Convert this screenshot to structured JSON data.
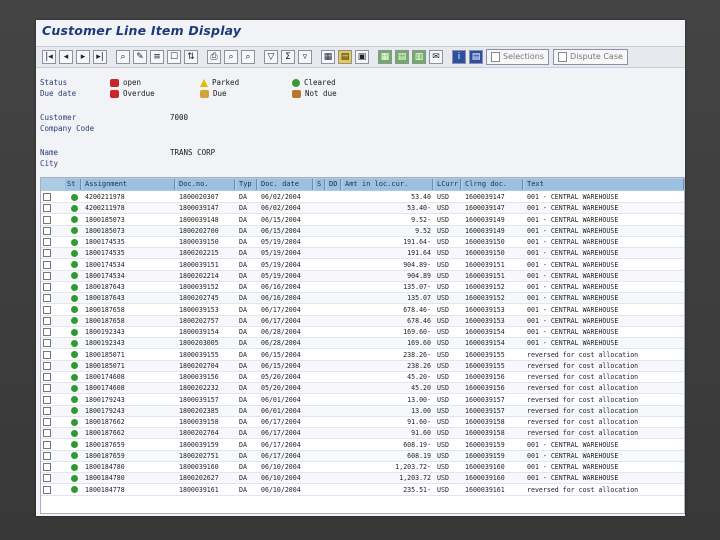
{
  "window": {
    "title": "Customer Line Item Display"
  },
  "toolbar": {
    "selections_label": "Selections",
    "dispute_label": "Dispute Case"
  },
  "legend": {
    "status_label": "Status",
    "due_date_label": "Due date",
    "open": "open",
    "overdue": "Overdue",
    "parked": "Parked",
    "due": "Due",
    "cleared": "Cleared",
    "not_due": "Not due"
  },
  "header": {
    "customer_label": "Customer",
    "company_code_label": "Company Code",
    "customer_value": "7000",
    "name_label": "Name",
    "city_label": "City",
    "name_value": "TRANS CORP"
  },
  "table": {
    "columns": [
      "St",
      "Assignment",
      "Doc.no.",
      "Typ",
      "Doc. date",
      "S",
      "DD",
      "Amt in loc.cur.",
      "LCurr",
      "Clrng doc.",
      "Text"
    ],
    "rows": [
      [
        "4200211978",
        "1800020307",
        "DA",
        "06/02/2004",
        "53.40",
        "USD",
        "1600039147",
        "001 - CENTRAL WAREHOUSE"
      ],
      [
        "4200211978",
        "1800039147",
        "DA",
        "06/02/2004",
        "53.40-",
        "USD",
        "1600039147",
        "001 - CENTRAL WAREHOUSE"
      ],
      [
        "1800185073",
        "1800039148",
        "DA",
        "06/15/2004",
        "9.52-",
        "USD",
        "1600039149",
        "001 - CENTRAL WAREHOUSE"
      ],
      [
        "1800185073",
        "1800202700",
        "DA",
        "06/15/2004",
        "9.52",
        "USD",
        "1600039149",
        "001 - CENTRAL WAREHOUSE"
      ],
      [
        "1800174535",
        "1800039150",
        "DA",
        "05/19/2004",
        "191.64-",
        "USD",
        "1600039150",
        "001 - CENTRAL WAREHOUSE"
      ],
      [
        "1800174535",
        "1800202215",
        "DA",
        "05/19/2004",
        "191.64",
        "USD",
        "1600039150",
        "001 - CENTRAL WAREHOUSE"
      ],
      [
        "1800174534",
        "1800039151",
        "DA",
        "05/19/2004",
        "904.89-",
        "USD",
        "1600039151",
        "001 - CENTRAL WAREHOUSE"
      ],
      [
        "1800174534",
        "1800202214",
        "DA",
        "05/19/2004",
        "904.89",
        "USD",
        "1600039151",
        "001 - CENTRAL WAREHOUSE"
      ],
      [
        "1800187643",
        "1800039152",
        "DA",
        "06/16/2004",
        "135.07-",
        "USD",
        "1600039152",
        "001 - CENTRAL WAREHOUSE"
      ],
      [
        "1800187643",
        "1800202745",
        "DA",
        "06/16/2004",
        "135.07",
        "USD",
        "1600039152",
        "001 - CENTRAL WAREHOUSE"
      ],
      [
        "1800187658",
        "1800039153",
        "DA",
        "06/17/2004",
        "678.46-",
        "USD",
        "1600039153",
        "001 - CENTRAL WAREHOUSE"
      ],
      [
        "1800187658",
        "1800202757",
        "DA",
        "06/17/2004",
        "678.46",
        "USD",
        "1600039153",
        "001 - CENTRAL WAREHOUSE"
      ],
      [
        "1800192343",
        "1800039154",
        "DA",
        "06/28/2004",
        "169.60-",
        "USD",
        "1600039154",
        "001 - CENTRAL WAREHOUSE"
      ],
      [
        "1800192343",
        "1800203005",
        "DA",
        "06/28/2004",
        "169.60",
        "USD",
        "1600039154",
        "001 - CENTRAL WAREHOUSE"
      ],
      [
        "1800185071",
        "1800039155",
        "DA",
        "06/15/2004",
        "238.26-",
        "USD",
        "1600039155",
        "reversed for cost allocation"
      ],
      [
        "1800185071",
        "1800202704",
        "DA",
        "06/15/2004",
        "238.26",
        "USD",
        "1600039155",
        "reversed for cost allocation"
      ],
      [
        "1800174608",
        "1800039156",
        "DA",
        "05/20/2004",
        "45.20-",
        "USD",
        "1600039156",
        "reversed for cost allocation"
      ],
      [
        "1800174608",
        "1800202232",
        "DA",
        "05/20/2004",
        "45.20",
        "USD",
        "1600039156",
        "reversed for cost allocation"
      ],
      [
        "1800179243",
        "1800039157",
        "DA",
        "06/01/2004",
        "13.00-",
        "USD",
        "1600039157",
        "reversed for cost allocation"
      ],
      [
        "1800179243",
        "1800202385",
        "DA",
        "06/01/2004",
        "13.00",
        "USD",
        "1600039157",
        "reversed for cost allocation"
      ],
      [
        "1800187662",
        "1800039158",
        "DA",
        "06/17/2004",
        "91.60-",
        "USD",
        "1600039158",
        "reversed for cost allocation"
      ],
      [
        "1800187662",
        "1800202764",
        "DA",
        "06/17/2004",
        "91.60",
        "USD",
        "1600039158",
        "reversed for cost allocation"
      ],
      [
        "1800187659",
        "1800039159",
        "DA",
        "06/17/2004",
        "608.19-",
        "USD",
        "1600039159",
        "001 - CENTRAL WAREHOUSE"
      ],
      [
        "1800187659",
        "1800202751",
        "DA",
        "06/17/2004",
        "608.19",
        "USD",
        "1600039159",
        "001 - CENTRAL WAREHOUSE"
      ],
      [
        "1800184780",
        "1800039160",
        "DA",
        "06/10/2004",
        "1,203.72-",
        "USD",
        "1600039160",
        "001 - CENTRAL WAREHOUSE"
      ],
      [
        "1800184780",
        "1800202627",
        "DA",
        "06/10/2004",
        "1,203.72",
        "USD",
        "1600039160",
        "001 - CENTRAL WAREHOUSE"
      ],
      [
        "1800184778",
        "1800039161",
        "DA",
        "06/10/2004",
        "235.51-",
        "USD",
        "1600039161",
        "reversed for cost allocation"
      ]
    ]
  }
}
